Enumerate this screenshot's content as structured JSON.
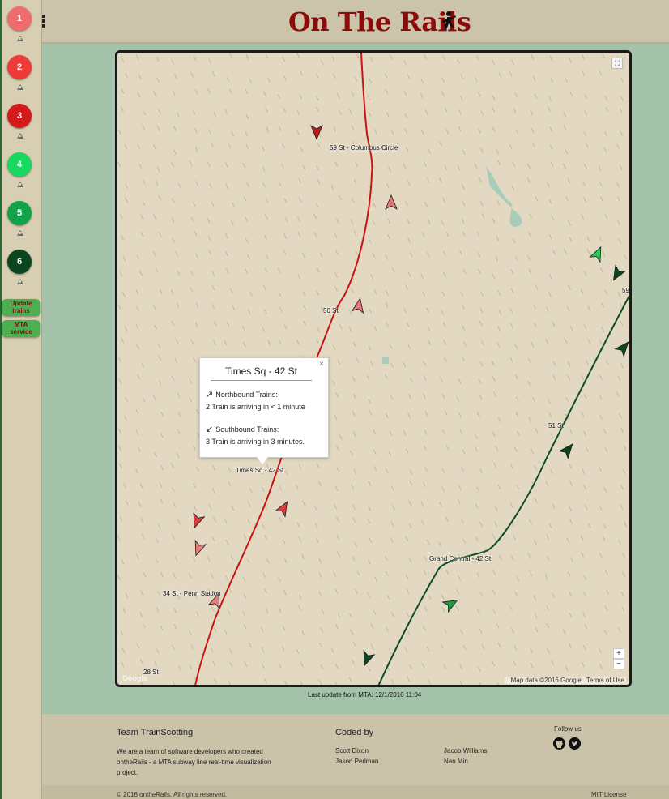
{
  "app": {
    "title": "On The Rails"
  },
  "sidebar": {
    "lines": [
      {
        "label": "1",
        "color": "#f06b6b"
      },
      {
        "label": "2",
        "color": "#ef3a3a"
      },
      {
        "label": "3",
        "color": "#d41a1a"
      },
      {
        "label": "4",
        "color": "#18d860"
      },
      {
        "label": "5",
        "color": "#12a34a"
      },
      {
        "label": "6",
        "color": "#0c4620"
      }
    ],
    "update_trains_label": "Update trains",
    "update_trains_lines": [
      "Update",
      "trains"
    ],
    "mta_service_lines": [
      "MTA",
      "service"
    ],
    "alert_icon": "warning-triangle-icon"
  },
  "map": {
    "stations": {
      "columbus": "59 St - Columbus Circle",
      "st50": "50 St",
      "times_sq": "Times Sq - 42 St",
      "st51": "51 St",
      "grand_central": "Grand Central - 42 St",
      "penn": "34 St - Penn Station",
      "st28": "28 St",
      "st59": "59"
    },
    "popup": {
      "close": "×",
      "title": "Times Sq - 42 St",
      "north_arrow": "↗",
      "north_heading": "Northbound Trains:",
      "north_info": "2 Train is arriving in < 1 minute",
      "south_arrow": "↙",
      "south_heading": "Southbound Trains:",
      "south_info": "3 Train is arriving in 3 minutes."
    },
    "zoom_in": "+",
    "zoom_out": "−",
    "fullscreen_icon": "⛶",
    "google_logo": "Google",
    "map_data": "Map data ©2016 Google",
    "terms": "Terms of Use",
    "colors": {
      "red_line": "#c81414",
      "green_line": "#0b4d24",
      "land": "#e3d9c2",
      "park": "#a9cbb9"
    }
  },
  "status": {
    "last_update": "Last update from MTA: 12/1/2016 11:04"
  },
  "footer": {
    "team_title": "Team TrainScotting",
    "team_desc": "We are a team of software developers who created ontheRails - a MTA subway line real-time visualization project.",
    "coded_by": "Coded by",
    "names": [
      "Scott Dixon",
      "Jason Perlman",
      "Jacob Williams",
      "Nan Min"
    ],
    "follow": "Follow us",
    "copyright": "© 2016 ontheRails, All rights reserved.",
    "license": "MIT License",
    "github_icon": "github-icon",
    "twitter_icon": "twitter-icon"
  }
}
